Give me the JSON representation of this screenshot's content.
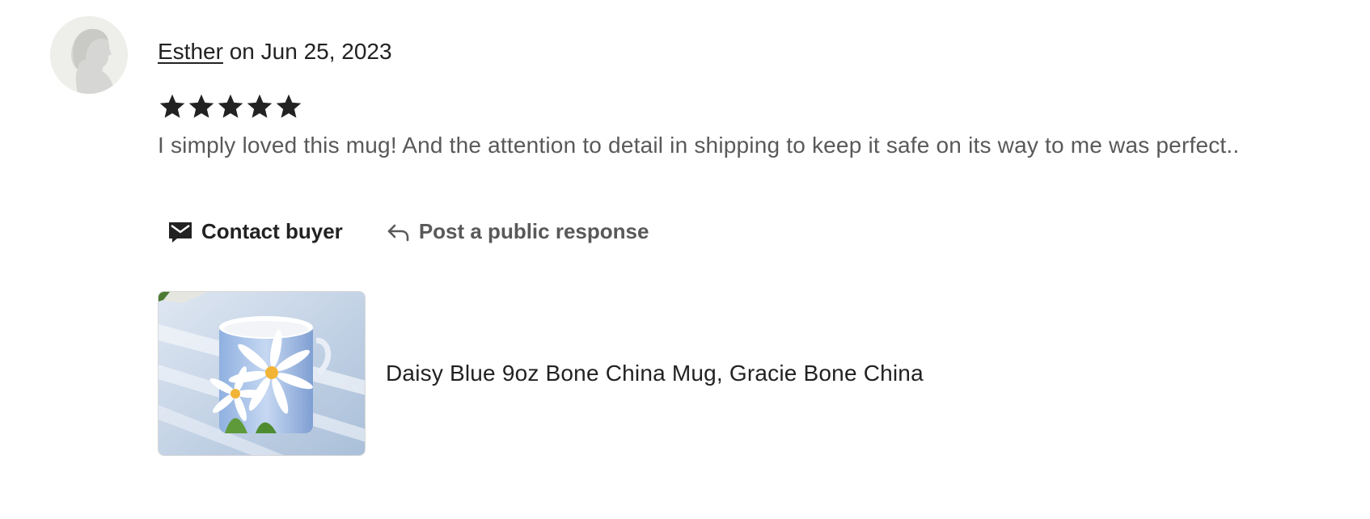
{
  "review": {
    "author": "Esther",
    "date_prefix": " on ",
    "date": "Jun 25, 2023",
    "rating": 5,
    "rating_max": 5,
    "text": "I simply loved this mug! And the attention to detail in shipping to keep it safe on its way to me was perfect.."
  },
  "actions": {
    "contact_label": "Contact buyer",
    "contact_icon": "envelope-icon",
    "respond_label": "Post a public response",
    "respond_icon": "reply-arrow-icon"
  },
  "listing": {
    "title": "Daisy Blue 9oz Bone China Mug, Gracie Bone China"
  },
  "colors": {
    "star": "#222222",
    "muted_text": "#595959",
    "avatar_bg": "#eeeeea"
  }
}
